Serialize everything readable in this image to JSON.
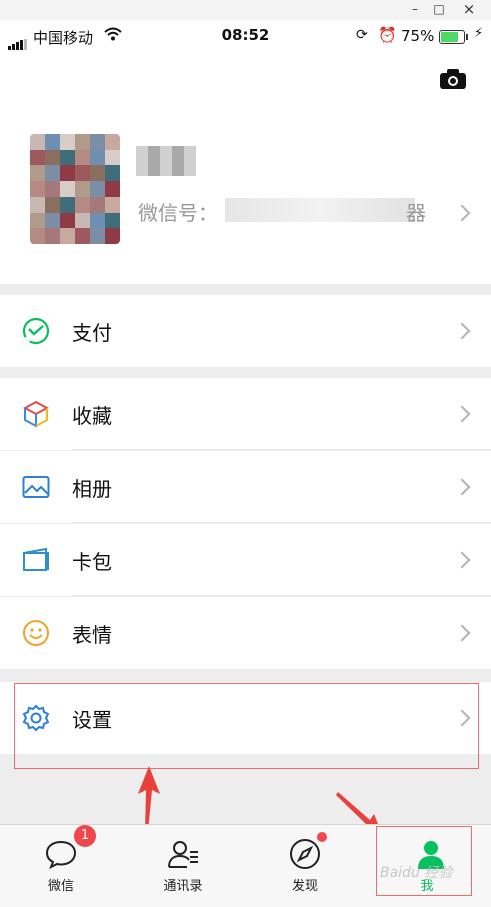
{
  "window": {
    "minimize": "–",
    "maximize": "□",
    "close": "×"
  },
  "status": {
    "carrier": "中国移动",
    "time": "08:52",
    "battery": "75%",
    "battery_level": 0.75
  },
  "profile": {
    "wechat_id_label": "微信号：",
    "id_suffix": "器"
  },
  "menu": {
    "pay": "支付",
    "favorites": "收藏",
    "album": "相册",
    "cards": "卡包",
    "stickers": "表情",
    "settings": "设置"
  },
  "tabs": [
    {
      "label": "微信",
      "badge": "1"
    },
    {
      "label": "通讯录"
    },
    {
      "label": "发现"
    },
    {
      "label": "我"
    }
  ],
  "watermark": "Baidu 经验",
  "colors": {
    "accent": "#07c160",
    "badge": "#f0474c",
    "highlight": "#f26b6b"
  }
}
